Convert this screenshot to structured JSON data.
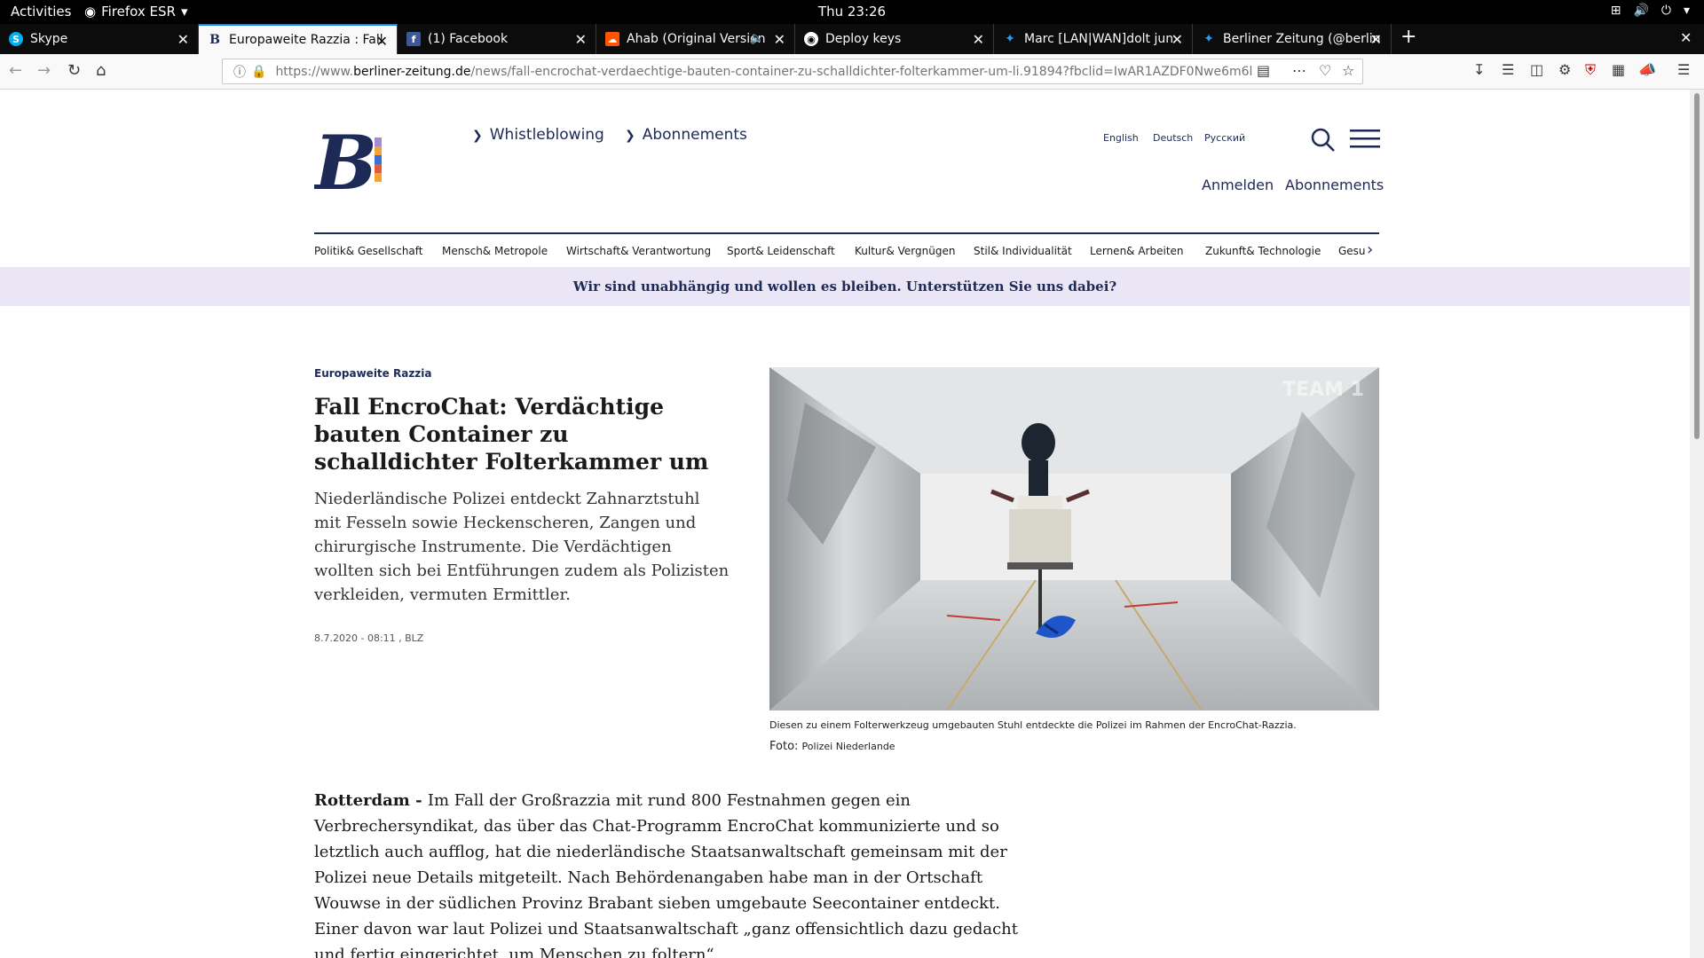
{
  "topbar": {
    "activities": "Activities",
    "app": "Firefox ESR",
    "clock": "Thu 23:26"
  },
  "tabs": [
    {
      "title": "Skype",
      "icon": "skype-icon"
    },
    {
      "title": "Europaweite Razzia : Fall",
      "icon": "berliner-zeitung-icon",
      "active": true
    },
    {
      "title": "(1) Facebook",
      "icon": "facebook-icon"
    },
    {
      "title": "Ahab (Original Version",
      "icon": "soundcloud-icon",
      "audio": true
    },
    {
      "title": "Deploy keys",
      "icon": "github-icon"
    },
    {
      "title": "Marc [LAN|WAN]dolt jun",
      "icon": "twitter-icon"
    },
    {
      "title": "Berliner Zeitung (@berlin",
      "icon": "twitter-icon"
    }
  ],
  "url": {
    "scheme": "https://www.",
    "host": "berliner-zeitung.de",
    "path": "/news/fall-encrochat-verdaechtige-bauten-container-zu-schalldichter-folterkammer-um-li.91894?fbclid=IwAR1AZDF0Nwe6m6l"
  },
  "site": {
    "topnav": [
      "Whistleblowing",
      "Abonnements"
    ],
    "languages": [
      "English",
      "Deutsch",
      "Русский"
    ],
    "account": {
      "login": "Anmelden",
      "subscribe": "Abonnements"
    },
    "categories": [
      "Politik& Gesellschaft",
      "Mensch& Metropole",
      "Wirtschaft& Verantwortung",
      "Sport& Leidenschaft",
      "Kultur& Vergnügen",
      "Stil& Individualität",
      "Lernen& Arbeiten",
      "Zukunft& Technologie",
      "Gesu"
    ],
    "banner": "Wir sind unabhängig und wollen es bleiben. Unterstützen Sie uns dabei?",
    "brand_colors": {
      "navy": "#1d2a55",
      "orange": "#f0a33a",
      "blue": "#3a6fd6",
      "purple": "#a58ad6",
      "red": "#e05a3a"
    }
  },
  "article": {
    "kicker": "Europaweite Razzia",
    "headline": "Fall EncroChat: Verdächtige bauten Container zu schalldichter Folterkammer um",
    "teaser": "Niederländische Polizei entdeckt Zahnarztstuhl mit Fesseln sowie Heckenscheren, Zangen und chirurgische Instrumente. Die Verdächtigen wollten sich bei Entführungen zudem als Polizisten verkleiden, vermuten Ermittler.",
    "dateline": "8.7.2020 - 08:11 , BLZ",
    "image_watermark": "TEAM 1",
    "caption": "Diesen zu einem Folterwerkzeug umgebauten Stuhl entdeckte die Polizei im Rahmen der EncroChat-Razzia.",
    "credit_label": "Foto:",
    "credit_source": "Polizei Niederlande",
    "body_location": "Rotterdam - ",
    "body_text": "Im Fall der Großrazzia mit rund 800 Festnahmen gegen ein Verbrechersyndikat, das über das Chat-Programm EncroChat kommunizierte und so letztlich auch aufflog, hat die niederländische Staatsanwaltschaft gemeinsam mit der Polizei neue Details mitgeteilt. Nach Behördenangaben habe man in der Ortschaft Wouwse in der südlichen Provinz Brabant sieben umgebaute Seecontainer entdeckt. Einer davon war laut Polizei und Staatsanwaltschaft „ganz offensichtlich dazu gedacht und fertig eingerichtet, um Menschen zu foltern“."
  }
}
